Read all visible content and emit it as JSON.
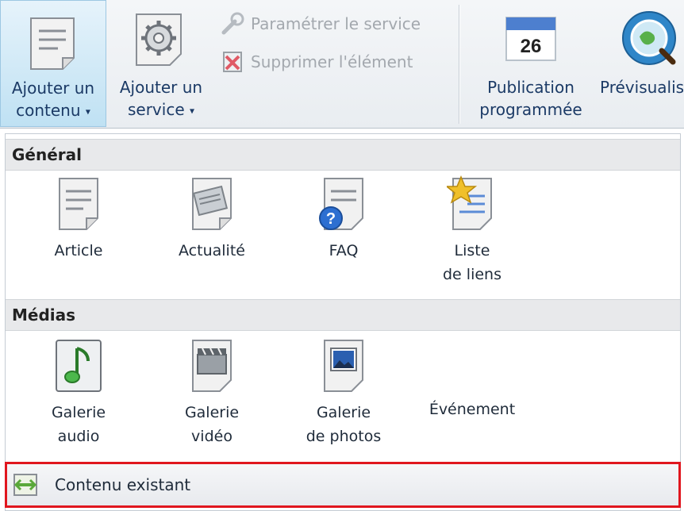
{
  "ribbon": {
    "add_content": {
      "line1": "Ajouter un",
      "line2": "contenu",
      "caret": "▾"
    },
    "add_service": {
      "line1": "Ajouter un",
      "line2": "service",
      "caret": "▾"
    },
    "configure_service": "Paramétrer le service",
    "delete_item": "Supprimer l'élément",
    "scheduled_publication": {
      "line1": "Publication",
      "line2": "programmée",
      "day": "26"
    },
    "preview": "Prévisualis"
  },
  "menu": {
    "groups": [
      {
        "title": "Général",
        "items": [
          {
            "label": "Article",
            "icon": "article-icon"
          },
          {
            "label": "Actualité",
            "icon": "news-icon"
          },
          {
            "label": "FAQ",
            "icon": "faq-icon"
          },
          {
            "label": "Liste\nde liens",
            "icon": "link-list-icon"
          }
        ]
      },
      {
        "title": "Médias",
        "items": [
          {
            "label": "Galerie\naudio",
            "icon": "audio-gallery-icon"
          },
          {
            "label": "Galerie\nvidéo",
            "icon": "video-gallery-icon"
          },
          {
            "label": "Galerie\nde photos",
            "icon": "photo-gallery-icon"
          },
          {
            "label": "Événement",
            "icon": "event-icon"
          }
        ]
      }
    ],
    "existing_content": "Contenu existant"
  },
  "colors": {
    "highlight_border": "#e0161e",
    "active_button": "#bfe1f3",
    "link_text": "#1b3a66"
  }
}
